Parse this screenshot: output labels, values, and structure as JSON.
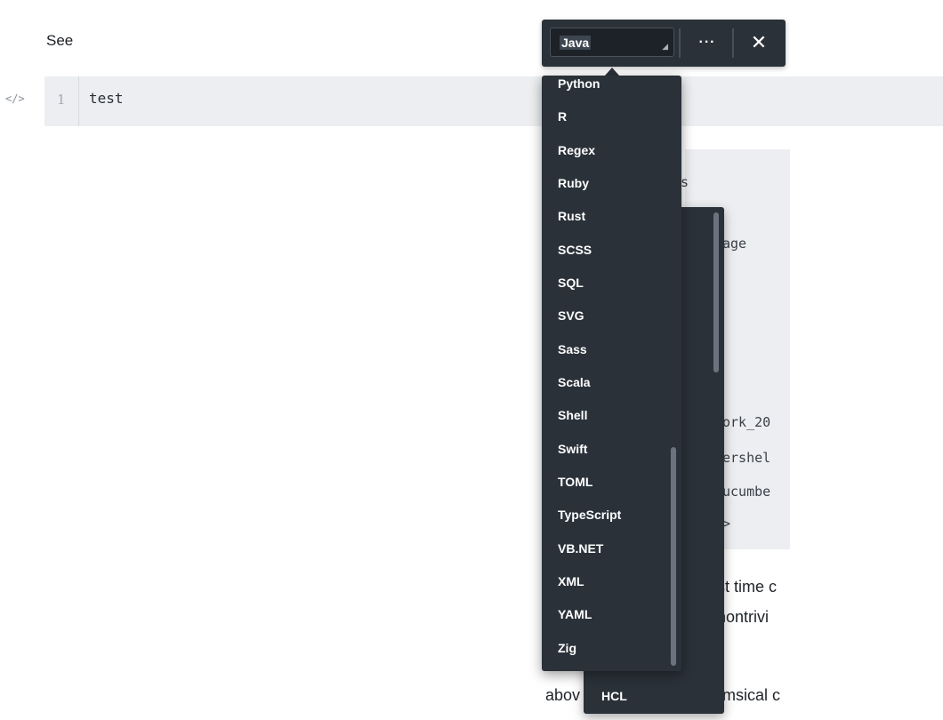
{
  "editor": {
    "prefix_text": "See",
    "line_number": "1",
    "code_line": "test"
  },
  "background_fragments": {
    "mono": [
      "s",
      "age",
      "ork_20",
      "ershel",
      "ucumbe",
      ">"
    ],
    "para": [
      "st time c",
      "nontrivi",
      "abov",
      "msical c"
    ]
  },
  "toolbar": {
    "language_value": "Java",
    "more_label": "···",
    "close_label": "✕"
  },
  "dropdown": {
    "items": [
      "Python",
      "R",
      "Regex",
      "Ruby",
      "Rust",
      "SCSS",
      "SQL",
      "SVG",
      "Sass",
      "Scala",
      "Shell",
      "Swift",
      "TOML",
      "TypeScript",
      "VB.NET",
      "XML",
      "YAML",
      "Zig"
    ]
  },
  "dropdown_back": {
    "item": "HCL"
  },
  "colors": {
    "toolbar_bg": "#2a3139",
    "code_row_bg": "#eceef1"
  },
  "icons": {
    "code_block": "code-icon",
    "more": "more-icon",
    "close": "close-icon"
  }
}
